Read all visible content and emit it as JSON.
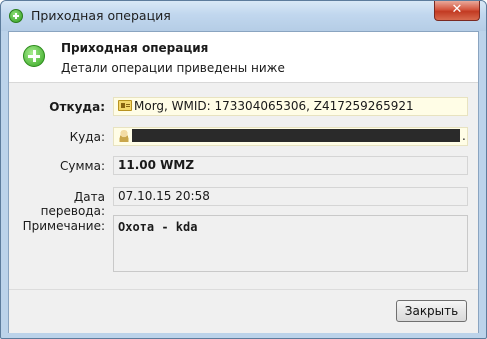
{
  "window": {
    "title": "Приходная операция",
    "close_symbol": "✕"
  },
  "header": {
    "title": "Приходная операция",
    "subtitle": "Детали операции приведены ниже",
    "icon": "add-circle-icon"
  },
  "fields": {
    "from": {
      "label": "Откуда:",
      "value": "Morg, WMID: 173304065306, Z417259265921",
      "icon": "id-card-icon"
    },
    "to": {
      "label": "Куда:",
      "trailing": ".",
      "icon": "user-icon"
    },
    "amount": {
      "label": "Сумма:",
      "value": "11.00 WMZ"
    },
    "date": {
      "label": "Дата перевода:",
      "value": "07.10.15 20:58"
    },
    "note": {
      "label": "Примечание:",
      "value": "Охота - kda"
    }
  },
  "footer": {
    "close_label": "Закрыть"
  },
  "colors": {
    "title_bar": "#c1d7ee",
    "close_button": "#c23a22",
    "highlight_field": "#fffde6",
    "redaction": "#2a2a2a"
  }
}
